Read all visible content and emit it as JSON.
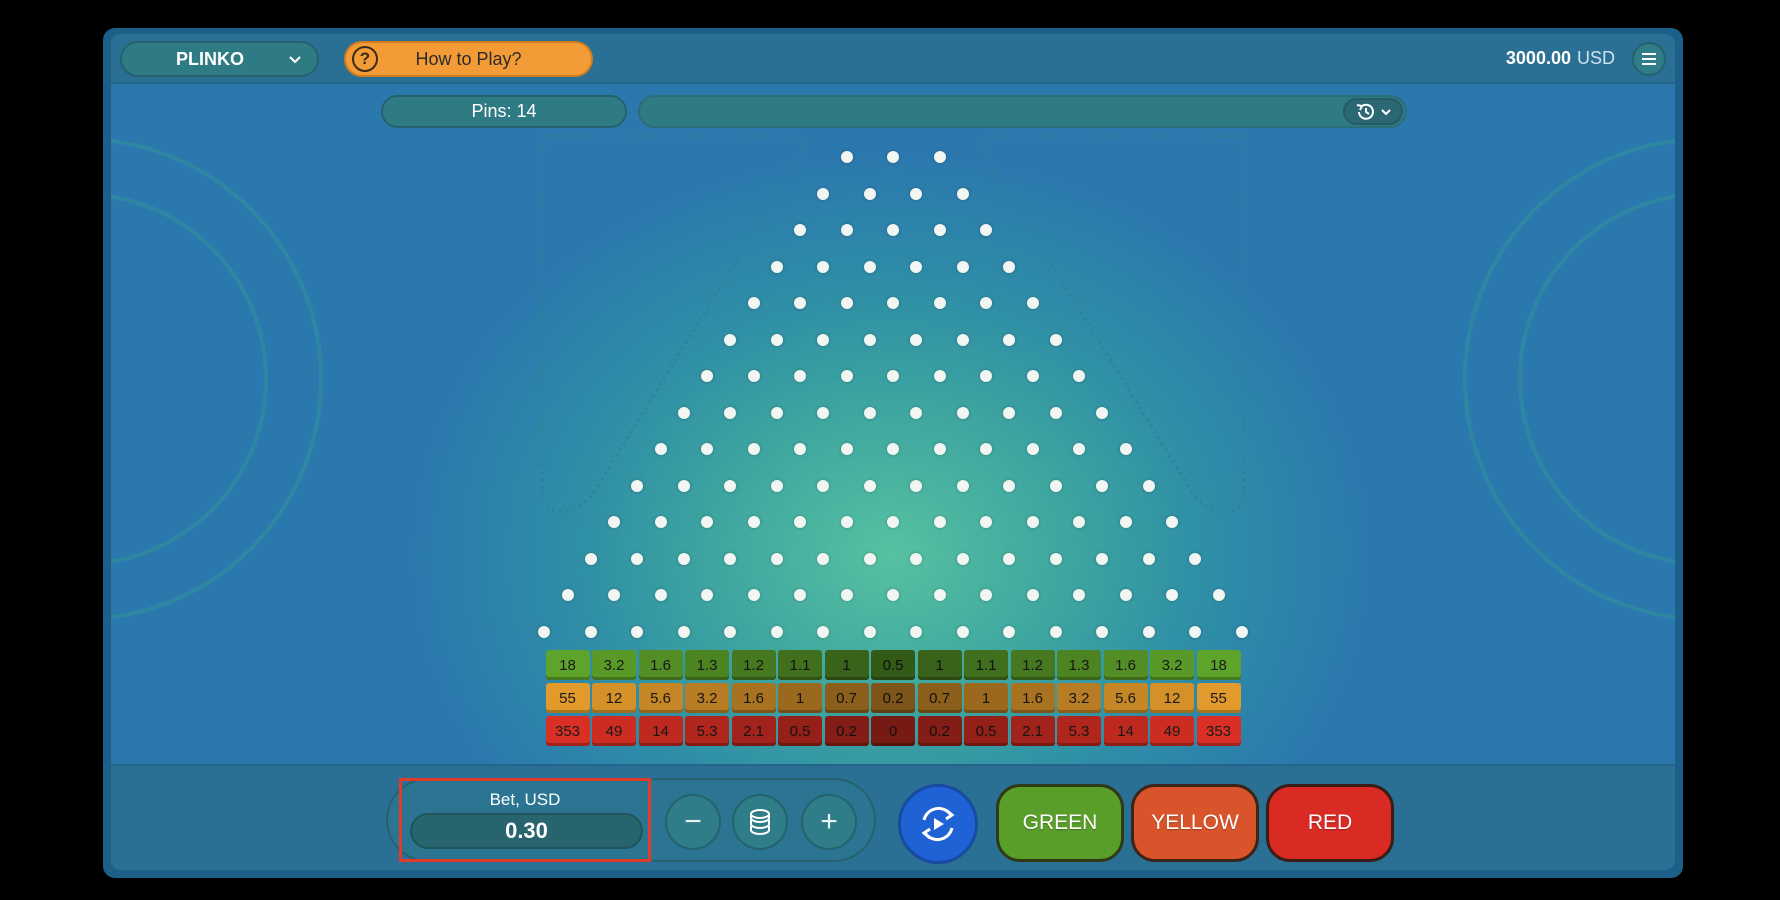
{
  "header": {
    "game_name": "PLINKO",
    "how_to_play": "How to Play?",
    "help_symbol": "?",
    "balance_amount": "3000.00",
    "balance_currency": "USD"
  },
  "controls": {
    "pins_label": "Pins: 14"
  },
  "board": {
    "pin_rows": 14,
    "multipliers": {
      "green": [
        "18",
        "3.2",
        "1.6",
        "1.3",
        "1.2",
        "1.1",
        "1",
        "0.5",
        "1",
        "1.1",
        "1.2",
        "1.3",
        "1.6",
        "3.2",
        "18"
      ],
      "yellow": [
        "55",
        "12",
        "5.6",
        "3.2",
        "1.6",
        "1",
        "0.7",
        "0.2",
        "0.7",
        "1",
        "1.6",
        "3.2",
        "5.6",
        "12",
        "55"
      ],
      "red": [
        "353",
        "49",
        "14",
        "5.3",
        "2.1",
        "0.5",
        "0.2",
        "0",
        "0.2",
        "0.5",
        "2.1",
        "5.3",
        "14",
        "49",
        "353"
      ]
    },
    "colors": {
      "green": "#5ea32a",
      "yellow": "#e39a2c",
      "red": "#d92f24"
    }
  },
  "bet": {
    "label": "Bet, USD",
    "value": "0.30",
    "minus": "−",
    "plus": "+"
  },
  "play_buttons": {
    "green": "GREEN",
    "yellow": "YELLOW",
    "red": "RED"
  }
}
